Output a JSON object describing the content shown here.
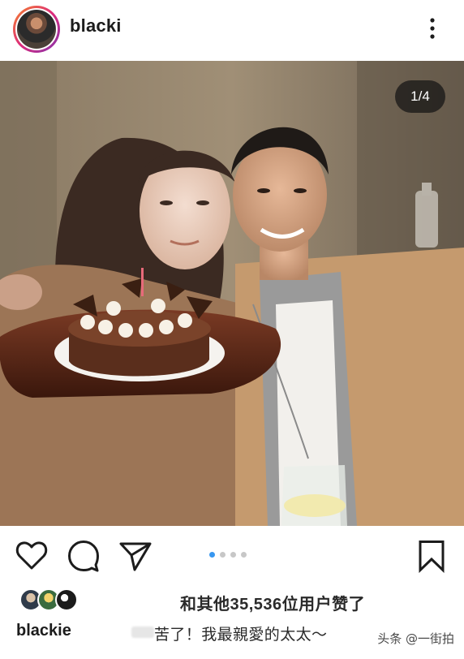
{
  "post": {
    "username": "blacki",
    "more_icon": "more-vertical-icon",
    "image_counter": "1/4",
    "carousel": {
      "total": 4,
      "current": 1
    }
  },
  "actions": {
    "like_icon": "heart-icon",
    "comment_icon": "comment-icon",
    "share_icon": "send-icon",
    "save_icon": "bookmark-icon"
  },
  "likes": {
    "text": "和其他35,536位用户赞了"
  },
  "caption": {
    "username": "blackie",
    "text": "苦了！我最親愛的太太～"
  },
  "watermark": {
    "text": "头条 @一街拍"
  },
  "colors": {
    "accent_blue": "#3897f0",
    "dot_gray": "#c7c7c7",
    "text_dark": "#1c1c1c",
    "counter_bg": "#141414"
  }
}
